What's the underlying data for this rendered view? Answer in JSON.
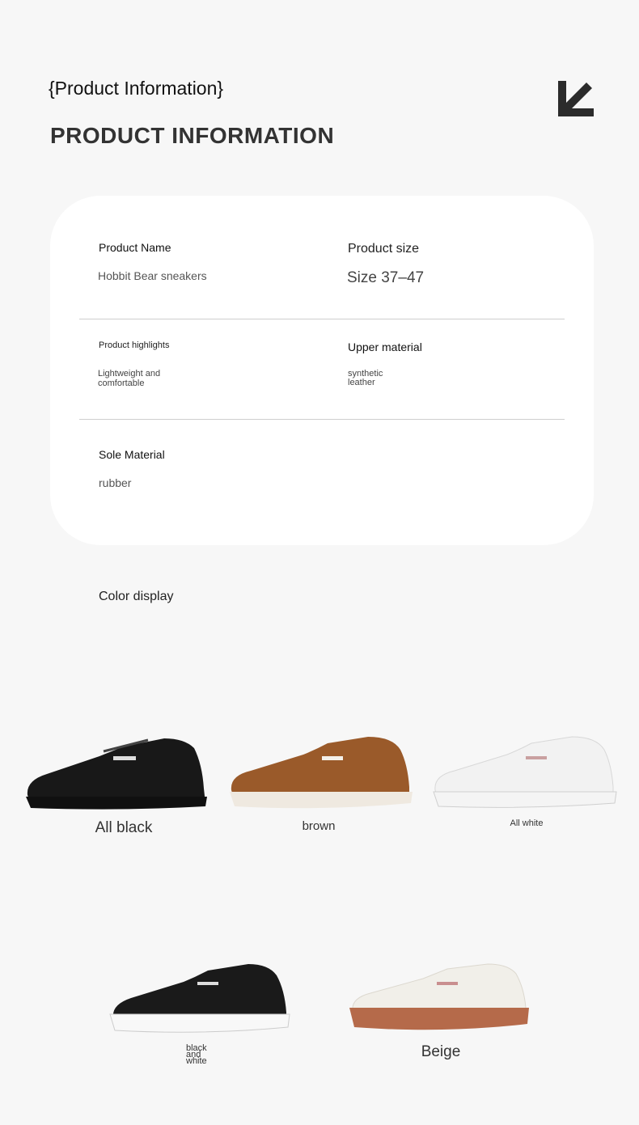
{
  "header": {
    "subtitle": "{Product Information}",
    "title": "PRODUCT INFORMATION",
    "arrow_icon": "arrow-down-left-icon"
  },
  "specs": {
    "product_name": {
      "label": "Product Name",
      "value": "Hobbit Bear sneakers"
    },
    "product_size": {
      "label": "Product size",
      "value": "Size 37–47"
    },
    "highlights": {
      "label": "Product highlights",
      "value_line1": "Lightweight and",
      "value_line2": "comfortable"
    },
    "upper_material": {
      "label": "Upper material",
      "value_line1": "synthetic",
      "value_line2": "leather"
    },
    "sole_material": {
      "label": "Sole Material",
      "value": "rubber"
    }
  },
  "colors": {
    "title": "Color display",
    "items": [
      {
        "label": "All black",
        "upper": "#1a1a1a",
        "sole": "#1e1e1e"
      },
      {
        "label": "brown",
        "upper": "#9a5a2a",
        "sole": "#efe9e0"
      },
      {
        "label": "All white",
        "upper": "#f2f2f2",
        "sole": "#f4f4f4"
      },
      {
        "label_lines": [
          "black",
          "and",
          "white"
        ],
        "upper": "#1a1a1a",
        "sole": "#f8f8f8"
      },
      {
        "label": "Beige",
        "upper": "#f1efe9",
        "sole": "#b56a4a"
      }
    ]
  }
}
